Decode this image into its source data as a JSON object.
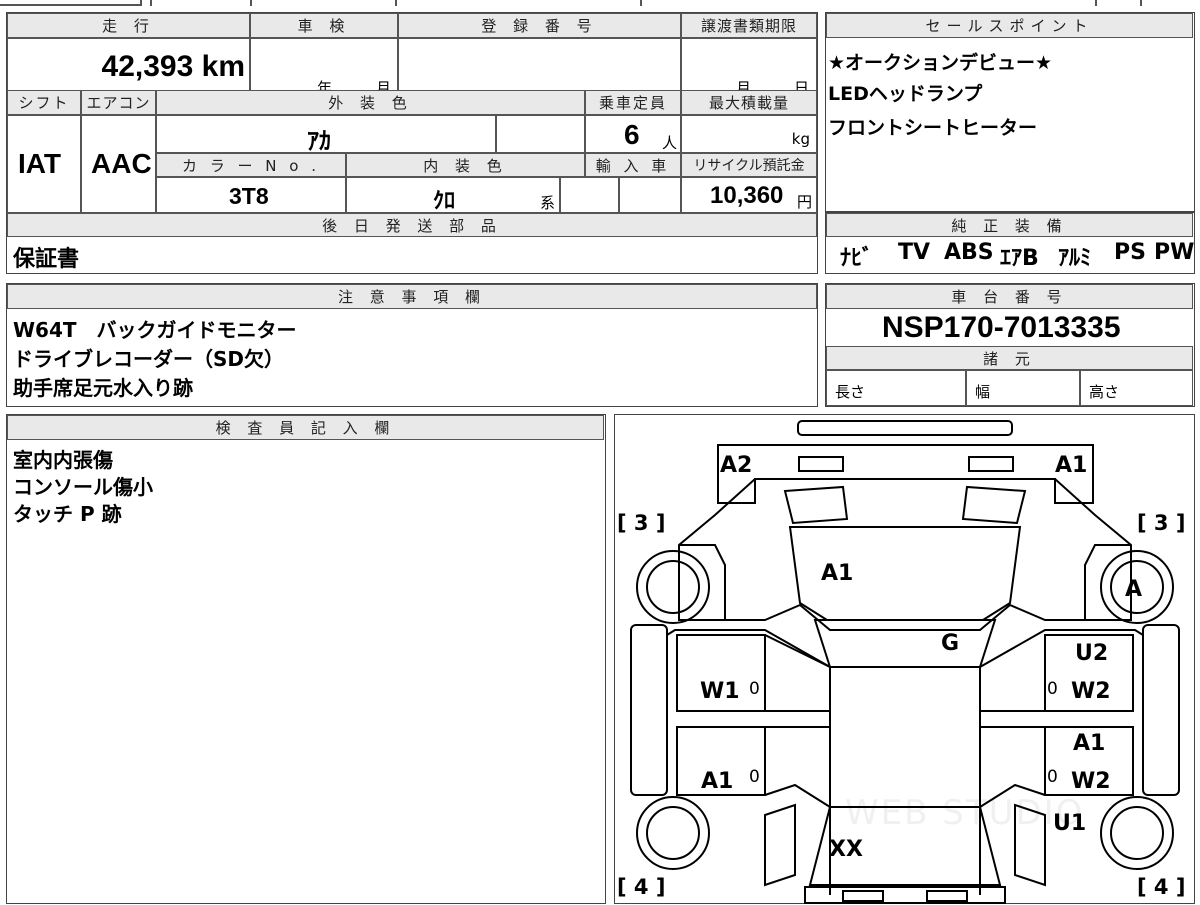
{
  "top_sheet": {
    "mileage": {
      "header": "走 行",
      "value": "42,393 km"
    },
    "inspection": {
      "header": "車 検",
      "year_unit": "年",
      "month_unit": "月"
    },
    "registration_number": {
      "header": "登 録 番 号"
    },
    "transfer_deadline": {
      "header": "譲渡書類期限",
      "month_unit": "月",
      "day_unit": "日"
    },
    "shift": {
      "header": "シフト",
      "value": "IAT"
    },
    "aircon": {
      "header": "エアコン",
      "value": "AAC"
    },
    "exterior_color": {
      "header": "外 装 色",
      "value": "ｱｶ"
    },
    "capacity": {
      "header": "乗車定員",
      "value": "6",
      "unit": "人"
    },
    "max_load": {
      "header": "最大積載量",
      "unit": "kg"
    },
    "color_no": {
      "header": "カ ラ ー N o .",
      "value": "3T8"
    },
    "interior_color": {
      "header": "内 装 色",
      "value": "ｸﾛ",
      "suffix": "系"
    },
    "imported": {
      "header": "輸 入 車"
    },
    "recycle_fee": {
      "header": "リサイクル預託金",
      "value": "10,360",
      "unit": "円"
    },
    "later_parts": {
      "header": "後 日 発 送 部 品",
      "value": "保証書"
    }
  },
  "sales_points": {
    "header": "セールスポイント",
    "lines": [
      "★オークションデビュー★",
      "LEDヘッドランプ",
      "フロントシートヒーター"
    ]
  },
  "equipment": {
    "header": "純 正 装 備",
    "items": [
      "ﾅﾋﾞ",
      "TV",
      "ABS",
      "ｴｱB",
      "ｱﾙﾐ",
      "PS",
      "PW"
    ]
  },
  "notes": {
    "header": "注 意 事 項 欄",
    "lines": [
      "W64T　バックガイドモニター",
      "ドライブレコーダー（SD欠）",
      "助手席足元水入り跡"
    ]
  },
  "chassis": {
    "header": "車 台 番 号",
    "value": "NSP170-7013335"
  },
  "specs": {
    "header": "諸 元",
    "length": "長さ",
    "width": "幅",
    "height": "高さ"
  },
  "inspector": {
    "header": "検 査 員 記 入 欄",
    "lines": [
      "室内内張傷",
      "コンソール傷小",
      "タッチ P 跡"
    ]
  },
  "diagram": {
    "marks": {
      "a2_front_left": "A2",
      "a1_front_right": "A1",
      "bracket_3_left": "[ 3 ]",
      "bracket_3_right": "[ 3 ]",
      "hood": "A1",
      "wheel_fr": "A",
      "windshield": "G",
      "door_fl": "W1",
      "door_rl": "A1",
      "door_fr_u": "U2",
      "door_fr_w": "W2",
      "door_rr_a": "A1",
      "door_rr_w": "W2",
      "rear_right_u": "U1",
      "roof_rear": "XX",
      "bracket_4_left": "[ 4 ]",
      "bracket_4_right": "[ 4 ]",
      "zero_mark": "0"
    },
    "watermark": "WEB STUDIO"
  }
}
